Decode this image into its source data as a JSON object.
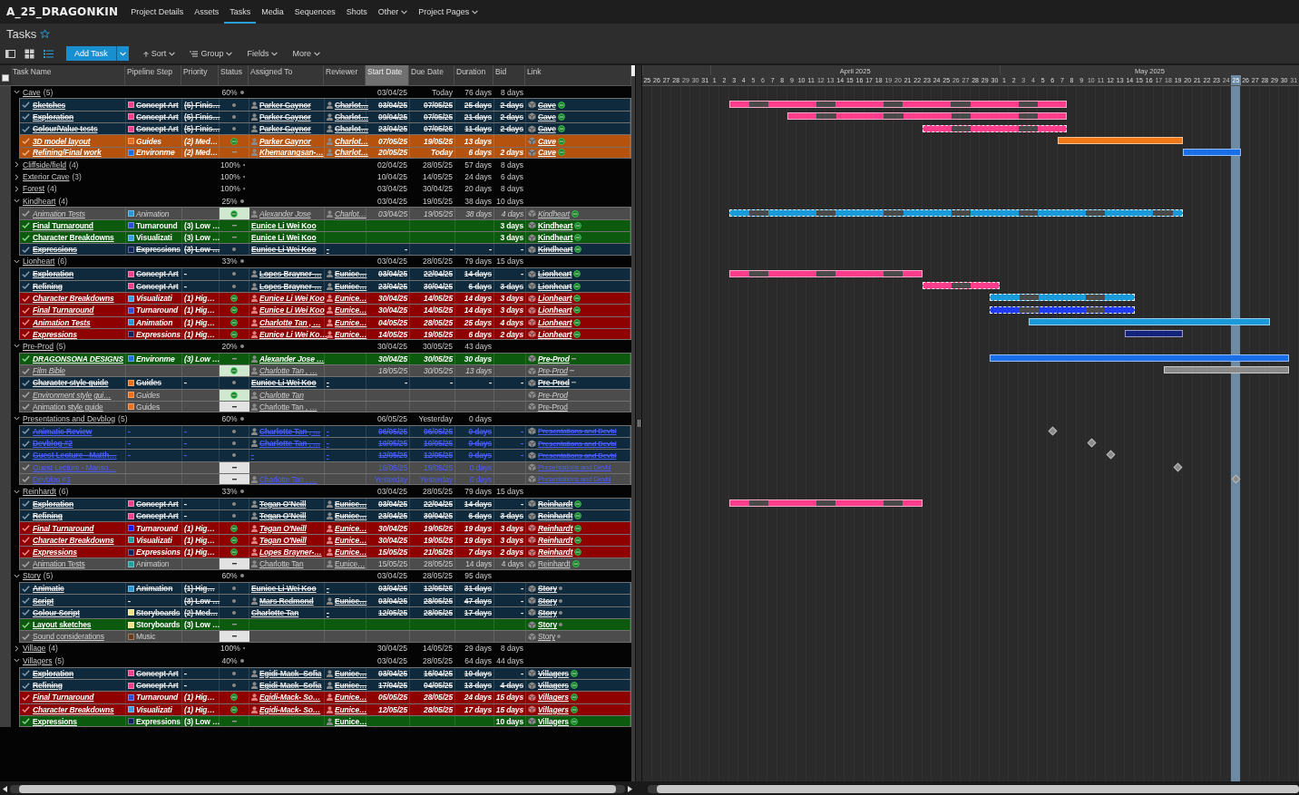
{
  "app": {
    "project": "A_25_DRAGONKIN"
  },
  "nav": [
    {
      "label": "Project Details",
      "selected": false,
      "menu": false
    },
    {
      "label": "Assets",
      "selected": false,
      "menu": false
    },
    {
      "label": "Tasks",
      "selected": true,
      "menu": false
    },
    {
      "label": "Media",
      "selected": false,
      "menu": false
    },
    {
      "label": "Sequences",
      "selected": false,
      "menu": false
    },
    {
      "label": "Shots",
      "selected": false,
      "menu": false
    },
    {
      "label": "Other",
      "selected": false,
      "menu": true
    },
    {
      "label": "Project Pages",
      "selected": false,
      "menu": true
    }
  ],
  "page": {
    "title": "Tasks",
    "favorite": false
  },
  "views": [
    {
      "kind": "detail",
      "selected": false
    },
    {
      "kind": "grid",
      "selected": false
    },
    {
      "kind": "list",
      "selected": true
    }
  ],
  "toolbar": {
    "add": "Add Task",
    "tools": [
      {
        "kind": "sort",
        "label": "Sort"
      },
      {
        "kind": "group",
        "label": "Group"
      },
      {
        "kind": "plain",
        "label": "Fields"
      },
      {
        "kind": "plain",
        "label": "More"
      }
    ]
  },
  "table": {
    "select_all": {
      "checked": false
    },
    "columns": [
      {
        "label": "Task Name",
        "sorted": false
      },
      {
        "label": "Pipeline Step",
        "sorted": false
      },
      {
        "label": "Priority",
        "sorted": false
      },
      {
        "label": "Status",
        "sorted": false
      },
      {
        "label": "Assigned To",
        "sorted": false
      },
      {
        "label": "Reviewer",
        "sorted": false
      },
      {
        "label": "Start Date",
        "sorted": true
      },
      {
        "label": "Due Date",
        "sorted": false
      },
      {
        "label": "Duration",
        "sorted": false
      },
      {
        "label": "Bid",
        "sorted": false
      },
      {
        "label": "Link",
        "sorted": false
      }
    ],
    "rows": [
      {
        "kind": "group",
        "expanded": true,
        "name": "Cave",
        "count": "(5)",
        "percent": "60%",
        "start": "03/04/25",
        "due": "Today",
        "duration": "76 days",
        "bid": "8 days"
      },
      {
        "kind": "done",
        "italic": false,
        "blue_text": false,
        "name": "Sketches",
        "step": {
          "label": "Concept Art",
          "color": "#f0408a"
        },
        "priority": "(5) Finis…",
        "status": {
          "kind": "final"
        },
        "assignee": "Parker Gaynor",
        "assignee_avatar": true,
        "reviewer": "Charlot…",
        "reviewer_avatar": true,
        "start": "03/04/25",
        "due": "07/05/25",
        "duration": "25 days",
        "bid": "2 days",
        "link": {
          "label": "Cave",
          "kind": "active"
        },
        "bar": {
          "kind": "split",
          "color": "#ff3d8b"
        }
      },
      {
        "kind": "done",
        "italic": false,
        "blue_text": false,
        "name": "Exploration",
        "step": {
          "label": "Concept Art",
          "color": "#f0408a"
        },
        "priority": "(5) Finis…",
        "status": {
          "kind": "final"
        },
        "assignee": "Parker Gaynor",
        "assignee_avatar": true,
        "reviewer": "Charlot…",
        "reviewer_avatar": true,
        "start": "09/04/25",
        "due": "07/05/25",
        "duration": "21 days",
        "bid": "2 days",
        "link": {
          "label": "Cave",
          "kind": "active"
        },
        "bar": {
          "kind": "split",
          "color": "#ff3d8b"
        }
      },
      {
        "kind": "done",
        "italic": false,
        "blue_text": false,
        "name": "Colour/Value tests",
        "step": {
          "label": "Concept Art",
          "color": "#f0408a"
        },
        "priority": "(5) Finis…",
        "status": {
          "kind": "final"
        },
        "assignee": "Parker Gaynor",
        "assignee_avatar": true,
        "reviewer": "Charlot…",
        "reviewer_avatar": true,
        "start": "23/04/25",
        "due": "07/05/25",
        "duration": "11 days",
        "bid": "2 days",
        "link": {
          "label": "Cave",
          "kind": "active"
        },
        "bar": {
          "kind": "dashed",
          "color": "#ff3d8b"
        }
      },
      {
        "kind": "late",
        "italic": true,
        "blue_text": false,
        "name": "3D model layout",
        "step": {
          "label": "Guides",
          "color": "#e8701a"
        },
        "priority": "(2) Med…",
        "status": {
          "kind": "ip"
        },
        "assignee": "Parker Gaynor",
        "assignee_avatar": true,
        "reviewer": "Charlot…",
        "reviewer_avatar": true,
        "start": "07/05/25",
        "due": "19/05/25",
        "duration": "13 days",
        "link": {
          "label": "Cave",
          "kind": "active"
        },
        "bar": {
          "kind": "solid",
          "color": "#f07818"
        }
      },
      {
        "kind": "late",
        "italic": true,
        "blue_text": false,
        "name": "Refining/Final work",
        "step": {
          "label": "Environme",
          "color": "#1a6ee8"
        },
        "priority": "(2) Med…",
        "status": {
          "kind": "wtg"
        },
        "assignee": "Khemarangsan-…",
        "assignee_avatar": true,
        "reviewer": "Charlot…",
        "reviewer_avatar": true,
        "start": "20/05/25",
        "due": "Today",
        "duration": "6 days",
        "bid": "2 days",
        "link": {
          "label": "Cave",
          "kind": "active"
        },
        "bar": {
          "kind": "solid",
          "color": "#1a6ee8"
        }
      },
      {
        "kind": "group",
        "expanded": false,
        "name": "Cliffside/field",
        "count": "(4)",
        "percent": "100%",
        "start": "02/04/25",
        "due": "28/05/25",
        "duration": "57 days",
        "bid": "8 days"
      },
      {
        "kind": "group",
        "expanded": false,
        "name": "Exterior Cave",
        "count": "(3)",
        "percent": "100%",
        "start": "10/04/25",
        "due": "14/05/25",
        "duration": "24 days",
        "bid": "6 days"
      },
      {
        "kind": "group",
        "expanded": false,
        "name": "Forest",
        "count": "(4)",
        "percent": "100%",
        "start": "03/04/25",
        "due": "30/04/25",
        "duration": "20 days",
        "bid": "8 days"
      },
      {
        "kind": "group",
        "expanded": true,
        "name": "Kindheart",
        "count": "(4)",
        "percent": "25%",
        "start": "03/04/25",
        "due": "19/05/25",
        "duration": "38 days",
        "bid": "10 days"
      },
      {
        "kind": "pending",
        "italic": true,
        "blue_text": false,
        "name": "Animation Tests",
        "step": {
          "label": "Animation",
          "color": "#2a96d4"
        },
        "status": {
          "kind": "ip_box"
        },
        "assignee": "Alexander Jose",
        "assignee_avatar": true,
        "reviewer": "Charlot…",
        "reviewer_avatar": true,
        "start": "03/04/25",
        "due": "19/05/25",
        "duration": "38 days",
        "bid": "4 days",
        "link": {
          "label": "Kindheart",
          "kind": "active"
        },
        "bar": {
          "kind": "dashed",
          "color": "#1a9ad8"
        }
      },
      {
        "kind": "active",
        "italic": false,
        "blue_text": false,
        "name": "Final Turnaround",
        "step": {
          "label": "Turnaround",
          "color": "#2b4fd0"
        },
        "priority": "(3) Low …",
        "status": {
          "kind": "wtg"
        },
        "assignee": "Eunice Li Wei Koo",
        "assignee_avatar": false,
        "bid": "3 days",
        "link": {
          "label": "Kindheart",
          "kind": "active"
        }
      },
      {
        "kind": "active",
        "italic": false,
        "blue_text": false,
        "name": "Character Breakdowns",
        "step": {
          "label": "Visualizati",
          "color": "#35a0e0"
        },
        "priority": "(3) Low …",
        "status": {
          "kind": "wtg"
        },
        "assignee": "Eunice Li Wei Koo",
        "assignee_avatar": false,
        "bid": "3 days",
        "link": {
          "label": "Kindheart",
          "kind": "active"
        }
      },
      {
        "kind": "done",
        "italic": false,
        "blue_text": false,
        "name": "Expressions",
        "step": {
          "label": "Expressions",
          "color": "#10205a"
        },
        "priority": "(3) Low …",
        "status": {
          "kind": "final"
        },
        "assignee": "Eunice Li Wei Koo",
        "assignee_avatar": false,
        "reviewer": "-",
        "reviewer_avatar": false,
        "start": "-",
        "due": "-",
        "duration": "-",
        "bid": "-",
        "link": {
          "label": "Kindheart",
          "kind": "active"
        }
      },
      {
        "kind": "group",
        "expanded": true,
        "name": "Lionheart",
        "count": "(6)",
        "percent": "33%",
        "start": "03/04/25",
        "due": "28/05/25",
        "duration": "79 days",
        "bid": "15 days"
      },
      {
        "kind": "done",
        "italic": false,
        "blue_text": false,
        "name": "Exploration",
        "step": {
          "label": "Concept Art",
          "color": "#f0408a"
        },
        "priority": "-",
        "status": {
          "kind": "final"
        },
        "assignee": "Lopes Brayner-…",
        "assignee_avatar": true,
        "reviewer": "Eunice…",
        "reviewer_avatar": true,
        "start": "03/04/25",
        "due": "22/04/25",
        "duration": "14 days",
        "bid": "-",
        "link": {
          "label": "Lionheart",
          "kind": "active"
        },
        "bar": {
          "kind": "split",
          "color": "#ff3d8b"
        }
      },
      {
        "kind": "done",
        "italic": false,
        "blue_text": false,
        "name": "Refining",
        "step": {
          "label": "Concept Art",
          "color": "#f0408a"
        },
        "priority": "-",
        "status": {
          "kind": "final"
        },
        "assignee": "Lopes Brayner-…",
        "assignee_avatar": true,
        "reviewer": "Eunice…",
        "reviewer_avatar": true,
        "start": "23/04/25",
        "due": "30/04/25",
        "duration": "6 days",
        "bid": "3 days",
        "link": {
          "label": "Lionheart",
          "kind": "active"
        },
        "bar": {
          "kind": "dashed",
          "color": "#ff3d8b"
        }
      },
      {
        "kind": "overdue",
        "italic": true,
        "blue_text": false,
        "name": "Character Breakdowns",
        "step": {
          "label": "Visualizati",
          "color": "#35a0e0"
        },
        "priority": "(1) Hig…",
        "status": {
          "kind": "ip"
        },
        "assignee": "Eunice Li Wei Koo",
        "assignee_avatar": true,
        "reviewer": "Eunice…",
        "reviewer_avatar": true,
        "start": "30/04/25",
        "due": "14/05/25",
        "duration": "14 days",
        "bid": "3 days",
        "link": {
          "label": "Lionheart",
          "kind": "active"
        },
        "bar": {
          "kind": "dashed",
          "color": "#1a9ad8"
        }
      },
      {
        "kind": "overdue",
        "italic": true,
        "blue_text": false,
        "name": "Final Turnaround",
        "step": {
          "label": "Turnaround",
          "color": "#2b4fd0"
        },
        "priority": "(1) Hig…",
        "status": {
          "kind": "ip"
        },
        "assignee": "Eunice Li Wei Koo",
        "assignee_avatar": true,
        "reviewer": "Eunice…",
        "reviewer_avatar": true,
        "start": "30/04/25",
        "due": "14/05/25",
        "duration": "14 days",
        "bid": "3 days",
        "link": {
          "label": "Lionheart",
          "kind": "active"
        },
        "bar": {
          "kind": "dashed",
          "color": "#1f3cf0"
        }
      },
      {
        "kind": "overdue",
        "italic": true,
        "blue_text": false,
        "name": "Animation Tests",
        "step": {
          "label": "Animation",
          "color": "#2a96d4"
        },
        "priority": "(1) Hig…",
        "status": {
          "kind": "ip"
        },
        "assignee": "Charlotte Tan , …",
        "assignee_avatar": true,
        "reviewer": "Eunice…",
        "reviewer_avatar": true,
        "start": "04/05/25",
        "due": "28/05/25",
        "duration": "25 days",
        "bid": "4 days",
        "link": {
          "label": "Lionheart",
          "kind": "active"
        },
        "bar": {
          "kind": "solid",
          "color": "#1a9ad8"
        }
      },
      {
        "kind": "overdue",
        "italic": true,
        "blue_text": false,
        "name": "Expressions",
        "step": {
          "label": "Expressions",
          "color": "#10205a"
        },
        "priority": "(1) Hig…",
        "status": {
          "kind": "ip"
        },
        "assignee": "Eunice Li Wei Ko…",
        "assignee_avatar": true,
        "reviewer": "Eunice…",
        "reviewer_avatar": true,
        "start": "14/05/25",
        "due": "19/05/25",
        "duration": "6 days",
        "bid": "2 days",
        "link": {
          "label": "Lionheart",
          "kind": "active"
        },
        "bar": {
          "kind": "solid",
          "color": "#14237a"
        }
      },
      {
        "kind": "group",
        "expanded": true,
        "name": "Pre-Prod",
        "count": "(5)",
        "percent": "20%",
        "start": "30/04/25",
        "due": "30/05/25",
        "duration": "43 days"
      },
      {
        "kind": "active",
        "italic": true,
        "blue_text": false,
        "name": "DRAGONSONA DESIGNS",
        "step": {
          "label": "Environme",
          "color": "#1a6ee8"
        },
        "priority": "(3) Low …",
        "status": {
          "kind": "wtg"
        },
        "assignee": "Alexander Jose …",
        "assignee_avatar": true,
        "start": "30/04/25",
        "due": "30/05/25",
        "duration": "30 days",
        "link": {
          "label": "Pre-Prod",
          "kind": "waiting"
        },
        "bar": {
          "kind": "solid",
          "color": "#1a6ee8"
        }
      },
      {
        "kind": "pending",
        "italic": true,
        "blue_text": false,
        "name": "Film Bible",
        "status": {
          "kind": "ip_box"
        },
        "assignee": "Charlotte Tan , …",
        "assignee_avatar": true,
        "start": "18/05/25",
        "due": "30/05/25",
        "duration": "13 days",
        "link": {
          "label": "Pre-Prod",
          "kind": "waiting"
        },
        "bar": {
          "kind": "solid",
          "color": "#8a8a8a"
        }
      },
      {
        "kind": "done",
        "italic": false,
        "blue_text": false,
        "name": "Character style guide",
        "step": {
          "label": "Guides",
          "color": "#e8701a"
        },
        "priority": "-",
        "status": {
          "kind": "final"
        },
        "assignee": "Eunice Li Wei Koo",
        "assignee_avatar": false,
        "reviewer": "-",
        "reviewer_avatar": false,
        "start": "-",
        "due": "-",
        "duration": "-",
        "bid": "-",
        "link": {
          "label": "Pre-Prod",
          "kind": "waiting"
        }
      },
      {
        "kind": "pending",
        "italic": true,
        "blue_text": false,
        "name": "Environment style gui…",
        "step": {
          "label": "Guides",
          "color": "#e8701a"
        },
        "status": {
          "kind": "ip_box"
        },
        "assignee": "Charlotte Tan",
        "assignee_avatar": true,
        "link": {
          "label": "Pre-Prod",
          "kind": "plain"
        }
      },
      {
        "kind": "pending",
        "italic": false,
        "blue_text": false,
        "name": "Animation style guide",
        "step": {
          "label": "Guides",
          "color": "#e8701a"
        },
        "status": {
          "kind": "wtg_box"
        },
        "assignee": "Charlotte Tan , …",
        "assignee_avatar": true,
        "link": {
          "label": "Pre-Prod",
          "kind": "plain"
        }
      },
      {
        "kind": "group",
        "expanded": true,
        "name": "Presentations and Devblog",
        "count": "(5)",
        "percent": "60%",
        "start": "06/05/25",
        "due": "Yesterday",
        "duration": "0 days"
      },
      {
        "kind": "done",
        "italic": false,
        "blue_text": true,
        "name": "Animatic Review",
        "step": {
          "label": "-"
        },
        "priority": "-",
        "status": {
          "kind": "final"
        },
        "assignee": "Charlotte Tan , …",
        "assignee_avatar": true,
        "reviewer": "-",
        "reviewer_avatar": false,
        "start": "06/05/25",
        "due": "06/05/25",
        "duration": "0 days",
        "bid": "-",
        "link": {
          "label": "Presentations and Devbl",
          "kind": "plain"
        },
        "bar": {
          "kind": "milestone",
          "color": "#8a8a8a"
        }
      },
      {
        "kind": "done",
        "italic": false,
        "blue_text": true,
        "name": "Devblog #2",
        "step": {
          "label": "-"
        },
        "priority": "-",
        "status": {
          "kind": "final"
        },
        "assignee": "Charlotte Tan , …",
        "assignee_avatar": true,
        "reviewer": "-",
        "reviewer_avatar": false,
        "start": "10/05/25",
        "due": "10/05/25",
        "duration": "0 days",
        "bid": "-",
        "link": {
          "label": "Presentations and Devbl",
          "kind": "plain"
        },
        "bar": {
          "kind": "milestone",
          "color": "#8a8a8a"
        }
      },
      {
        "kind": "done",
        "italic": false,
        "blue_text": true,
        "name": "Guest Lecture - Matth…",
        "step": {
          "label": "-"
        },
        "priority": "-",
        "status": {
          "kind": "final"
        },
        "assignee": "-",
        "assignee_avatar": false,
        "reviewer": "-",
        "reviewer_avatar": false,
        "start": "12/05/25",
        "due": "12/05/25",
        "duration": "0 days",
        "bid": "-",
        "link": {
          "label": "Presentations and Devbl",
          "kind": "plain"
        },
        "bar": {
          "kind": "milestone",
          "color": "#8a8a8a"
        }
      },
      {
        "kind": "pending",
        "italic": false,
        "blue_text": true,
        "name": "Guest Lecture - Manso…",
        "status": {
          "kind": "wtg_box"
        },
        "start": "19/05/25",
        "due": "19/05/25",
        "duration": "0 days",
        "link": {
          "label": "Presentations and Devbl",
          "kind": "plain"
        },
        "bar": {
          "kind": "milestone",
          "color": "#8a8a8a"
        }
      },
      {
        "kind": "pending",
        "italic": false,
        "blue_text": true,
        "name": "Devblog #3",
        "status": {
          "kind": "wtg_box"
        },
        "assignee": "Charlotte Tan , …",
        "assignee_avatar": true,
        "start": "Yesterday",
        "due": "Yesterday",
        "duration": "0 days",
        "link": {
          "label": "Presentations and Devbl",
          "kind": "plain"
        },
        "bar": {
          "kind": "milestone",
          "color": "#8a8a8a"
        }
      },
      {
        "kind": "group",
        "expanded": true,
        "name": "Reinhardt",
        "count": "(6)",
        "percent": "33%",
        "start": "03/04/25",
        "due": "28/05/25",
        "duration": "79 days",
        "bid": "15 days"
      },
      {
        "kind": "done",
        "italic": false,
        "blue_text": false,
        "name": "Exploration",
        "step": {
          "label": "Concept Art",
          "color": "#f0408a"
        },
        "priority": "-",
        "status": {
          "kind": "final"
        },
        "assignee": "Tegan O'Neill",
        "assignee_avatar": true,
        "reviewer": "Eunice…",
        "reviewer_avatar": true,
        "start": "03/04/25",
        "due": "22/04/25",
        "duration": "14 days",
        "bid": "-",
        "link": {
          "label": "Reinhardt",
          "kind": "active"
        },
        "bar": {
          "kind": "split",
          "color": "#ff3d8b"
        }
      },
      {
        "kind": "done",
        "italic": false,
        "blue_text": false,
        "name": "Refining",
        "step": {
          "label": "Concept Art",
          "color": "#f0408a"
        },
        "priority": "-",
        "status": {
          "kind": "final"
        },
        "assignee": "Tegan O'Neill",
        "assignee_avatar": true,
        "reviewer": "Eunice…",
        "reviewer_avatar": true,
        "start": "23/04/25",
        "due": "30/04/25",
        "duration": "6 days",
        "bid": "3 days",
        "link": {
          "label": "Reinhardt",
          "kind": "active"
        }
      },
      {
        "kind": "overdue",
        "italic": true,
        "blue_text": false,
        "name": "Final Turnaround",
        "step": {
          "label": "Turnaround",
          "color": "#1a1ae8"
        },
        "priority": "(1) Hig…",
        "status": {
          "kind": "ip"
        },
        "assignee": "Tegan O'Neill",
        "assignee_avatar": true,
        "reviewer": "Eunice…",
        "reviewer_avatar": true,
        "start": "30/04/25",
        "due": "19/05/25",
        "duration": "19 days",
        "bid": "3 days",
        "link": {
          "label": "Reinhardt",
          "kind": "active"
        }
      },
      {
        "kind": "overdue",
        "italic": true,
        "blue_text": false,
        "name": "Character Breakdowns",
        "step": {
          "label": "Visualizati",
          "color": "#20a0a0"
        },
        "priority": "(1) Hig…",
        "status": {
          "kind": "ip"
        },
        "assignee": "Tegan O'Neill",
        "assignee_avatar": true,
        "reviewer": "Eunice…",
        "reviewer_avatar": true,
        "start": "30/04/25",
        "due": "19/05/25",
        "duration": "19 days",
        "bid": "3 days",
        "link": {
          "label": "Reinhardt",
          "kind": "active"
        }
      },
      {
        "kind": "overdue",
        "italic": true,
        "blue_text": false,
        "name": "Expressions",
        "step": {
          "label": "Expressions",
          "color": "#10205a"
        },
        "priority": "(1) Hig…",
        "status": {
          "kind": "ip"
        },
        "assignee": "Lopes Brayner-…",
        "assignee_avatar": true,
        "reviewer": "Eunice…",
        "reviewer_avatar": true,
        "start": "15/05/25",
        "due": "21/05/25",
        "duration": "7 days",
        "bid": "2 days",
        "link": {
          "label": "Reinhardt",
          "kind": "active"
        }
      },
      {
        "kind": "pending",
        "italic": false,
        "blue_text": false,
        "name": "Animation Tests",
        "step": {
          "label": "Animation",
          "color": "#20a0a0"
        },
        "status": {
          "kind": "wtg_box"
        },
        "assignee": "Charlotte Tan",
        "assignee_avatar": true,
        "reviewer": "Eunice…",
        "reviewer_avatar": true,
        "start": "15/05/25",
        "due": "28/05/25",
        "duration": "14 days",
        "bid": "4 days",
        "link": {
          "label": "Reinhardt",
          "kind": "active"
        }
      },
      {
        "kind": "group",
        "expanded": true,
        "name": "Story",
        "count": "(5)",
        "percent": "60%",
        "start": "03/04/25",
        "due": "28/05/25",
        "duration": "95 days"
      },
      {
        "kind": "done",
        "italic": false,
        "blue_text": false,
        "name": "Animatic",
        "step": {
          "label": "Animation",
          "color": "#2a96d4"
        },
        "priority": "(1) Hig…",
        "status": {
          "kind": "final"
        },
        "assignee": "Eunice Li Wei Koo",
        "assignee_avatar": false,
        "reviewer": "-",
        "reviewer_avatar": false,
        "start": "03/04/25",
        "due": "12/05/25",
        "duration": "31 days",
        "bid": "-",
        "link": {
          "label": "Story",
          "kind": "closed"
        }
      },
      {
        "kind": "done",
        "italic": false,
        "blue_text": false,
        "name": "Script",
        "step": {
          "label": "-"
        },
        "priority": "(3) Low …",
        "status": {
          "kind": "final"
        },
        "assignee": "Mars Redmond",
        "assignee_avatar": true,
        "reviewer": "Eunice…",
        "reviewer_avatar": true,
        "start": "03/04/25",
        "due": "28/05/25",
        "duration": "47 days",
        "bid": "-",
        "link": {
          "label": "Story",
          "kind": "closed"
        }
      },
      {
        "kind": "done",
        "italic": false,
        "blue_text": false,
        "name": "Colour Script",
        "step": {
          "label": "Storyboards",
          "color": "#f0e08a"
        },
        "priority": "(2) Med…",
        "status": {
          "kind": "final"
        },
        "assignee": "Charlotte Tan",
        "assignee_avatar": false,
        "reviewer": "-",
        "reviewer_avatar": false,
        "start": "12/05/25",
        "due": "28/05/25",
        "duration": "17 days",
        "bid": "-",
        "link": {
          "label": "Story",
          "kind": "closed"
        }
      },
      {
        "kind": "active",
        "italic": false,
        "blue_text": false,
        "name": "Layout sketches",
        "step": {
          "label": "Storyboards",
          "color": "#f0e08a"
        },
        "priority": "(3) Low …",
        "status": {
          "kind": "wtg"
        },
        "link": {
          "label": "Story",
          "kind": "closed"
        }
      },
      {
        "kind": "pending",
        "italic": false,
        "blue_text": false,
        "name": "Sound considerations",
        "step": {
          "label": "Music",
          "color": "#6a3a1a"
        },
        "status": {
          "kind": "wtg_box"
        },
        "link": {
          "label": "Story",
          "kind": "closed"
        }
      },
      {
        "kind": "group",
        "expanded": false,
        "name": "Village",
        "count": "(4)",
        "percent": "100%",
        "start": "30/04/25",
        "due": "14/05/25",
        "duration": "29 days",
        "bid": "8 days"
      },
      {
        "kind": "group",
        "expanded": true,
        "name": "Villagers",
        "count": "(5)",
        "percent": "40%",
        "start": "03/04/25",
        "due": "28/05/25",
        "duration": "64 days",
        "bid": "44 days"
      },
      {
        "kind": "done",
        "italic": false,
        "blue_text": false,
        "name": "Exploration",
        "step": {
          "label": "Concept Art",
          "color": "#f0408a"
        },
        "priority": "-",
        "status": {
          "kind": "final"
        },
        "assignee": "Egidi-Mack- Sofia",
        "assignee_avatar": true,
        "reviewer": "Eunice…",
        "reviewer_avatar": true,
        "start": "03/04/25",
        "due": "16/04/25",
        "duration": "10 days",
        "bid": "-",
        "link": {
          "label": "Villagers",
          "kind": "active"
        }
      },
      {
        "kind": "done",
        "italic": false,
        "blue_text": false,
        "name": "Refining",
        "step": {
          "label": "Concept Art",
          "color": "#f0408a"
        },
        "priority": "-",
        "status": {
          "kind": "final"
        },
        "assignee": "Egidi-Mack- Sofia",
        "assignee_avatar": true,
        "reviewer": "Eunice…",
        "reviewer_avatar": true,
        "start": "17/04/25",
        "due": "04/05/25",
        "duration": "13 days",
        "bid": "4 days",
        "link": {
          "label": "Villagers",
          "kind": "active"
        }
      },
      {
        "kind": "overdue",
        "italic": true,
        "blue_text": false,
        "name": "Final Turnaround",
        "step": {
          "label": "Turnaround",
          "color": "#2b4fd0"
        },
        "priority": "(1) Hig…",
        "status": {
          "kind": "ip"
        },
        "assignee": "Egidi-Mack- So…",
        "assignee_avatar": true,
        "reviewer": "Eunice…",
        "reviewer_avatar": true,
        "start": "05/05/25",
        "due": "28/05/25",
        "duration": "24 days",
        "bid": "15 days",
        "link": {
          "label": "Villagers",
          "kind": "active"
        }
      },
      {
        "kind": "overdue",
        "italic": true,
        "blue_text": false,
        "name": "Character Breakdowns",
        "step": {
          "label": "Visualizati",
          "color": "#35a0e0"
        },
        "priority": "(1) Hig…",
        "status": {
          "kind": "ip"
        },
        "assignee": "Egidi-Mack- So…",
        "assignee_avatar": true,
        "reviewer": "Eunice…",
        "reviewer_avatar": true,
        "start": "12/05/25",
        "due": "28/05/25",
        "duration": "17 days",
        "bid": "15 days",
        "link": {
          "label": "Villagers",
          "kind": "active"
        }
      },
      {
        "kind": "active",
        "italic": false,
        "blue_text": false,
        "name": "Expressions",
        "step": {
          "label": "Expressions",
          "color": "#10205a"
        },
        "priority": "(3) Low …",
        "status": {
          "kind": "wtg"
        },
        "reviewer": "Eunice…",
        "reviewer_avatar": true,
        "bid": "10 days",
        "link": {
          "label": "Villagers",
          "kind": "active"
        }
      }
    ]
  },
  "timeline": {
    "months": [
      {
        "days": [
          {
            "label": "25",
            "weekend": false,
            "today": false
          },
          {
            "label": "26",
            "weekend": false,
            "today": false
          },
          {
            "label": "27",
            "weekend": false,
            "today": false
          },
          {
            "label": "28",
            "weekend": false,
            "today": false
          },
          {
            "label": "29",
            "weekend": true,
            "today": false
          },
          {
            "label": "30",
            "weekend": true,
            "today": false
          },
          {
            "label": "31",
            "weekend": false,
            "today": false
          }
        ]
      },
      {
        "label": "April 2025",
        "days": [
          {
            "label": "1",
            "weekend": false,
            "today": false
          },
          {
            "label": "2",
            "weekend": false,
            "today": false
          },
          {
            "label": "3",
            "weekend": false,
            "today": false
          },
          {
            "label": "4",
            "weekend": false,
            "today": false
          },
          {
            "label": "5",
            "weekend": true,
            "today": false
          },
          {
            "label": "6",
            "weekend": true,
            "today": false
          },
          {
            "label": "7",
            "weekend": false,
            "today": false
          },
          {
            "label": "8",
            "weekend": false,
            "today": false
          },
          {
            "label": "9",
            "weekend": false,
            "today": false
          },
          {
            "label": "10",
            "weekend": false,
            "today": false
          },
          {
            "label": "11",
            "weekend": false,
            "today": false
          },
          {
            "label": "12",
            "weekend": true,
            "today": false
          },
          {
            "label": "13",
            "weekend": true,
            "today": false
          },
          {
            "label": "14",
            "weekend": false,
            "today": false
          },
          {
            "label": "15",
            "weekend": false,
            "today": false
          },
          {
            "label": "16",
            "weekend": false,
            "today": false
          },
          {
            "label": "17",
            "weekend": false,
            "today": false
          },
          {
            "label": "18",
            "weekend": false,
            "today": false
          },
          {
            "label": "19",
            "weekend": true,
            "today": false
          },
          {
            "label": "20",
            "weekend": true,
            "today": false
          },
          {
            "label": "21",
            "weekend": false,
            "today": false
          },
          {
            "label": "22",
            "weekend": false,
            "today": false
          },
          {
            "label": "23",
            "weekend": false,
            "today": false
          },
          {
            "label": "24",
            "weekend": false,
            "today": false
          },
          {
            "label": "25",
            "weekend": false,
            "today": false
          },
          {
            "label": "26",
            "weekend": true,
            "today": false
          },
          {
            "label": "27",
            "weekend": true,
            "today": false
          },
          {
            "label": "28",
            "weekend": false,
            "today": false
          },
          {
            "label": "29",
            "weekend": false,
            "today": false
          },
          {
            "label": "30",
            "weekend": false,
            "today": false
          }
        ]
      },
      {
        "label": "May 2025",
        "days": [
          {
            "label": "1",
            "weekend": false,
            "today": false
          },
          {
            "label": "2",
            "weekend": false,
            "today": false
          },
          {
            "label": "3",
            "weekend": true,
            "today": false
          },
          {
            "label": "4",
            "weekend": true,
            "today": false
          },
          {
            "label": "5",
            "weekend": false,
            "today": false
          },
          {
            "label": "6",
            "weekend": false,
            "today": false
          },
          {
            "label": "7",
            "weekend": false,
            "today": false
          },
          {
            "label": "8",
            "weekend": false,
            "today": false
          },
          {
            "label": "9",
            "weekend": false,
            "today": false
          },
          {
            "label": "10",
            "weekend": true,
            "today": false
          },
          {
            "label": "11",
            "weekend": true,
            "today": false
          },
          {
            "label": "12",
            "weekend": false,
            "today": false
          },
          {
            "label": "13",
            "weekend": false,
            "today": false
          },
          {
            "label": "14",
            "weekend": false,
            "today": false
          },
          {
            "label": "15",
            "weekend": false,
            "today": false
          },
          {
            "label": "16",
            "weekend": false,
            "today": false
          },
          {
            "label": "17",
            "weekend": true,
            "today": false
          },
          {
            "label": "18",
            "weekend": true,
            "today": false
          },
          {
            "label": "19",
            "weekend": false,
            "today": false
          },
          {
            "label": "20",
            "weekend": false,
            "today": false
          },
          {
            "label": "21",
            "weekend": false,
            "today": false
          },
          {
            "label": "22",
            "weekend": false,
            "today": false
          },
          {
            "label": "23",
            "weekend": false,
            "today": false
          },
          {
            "label": "24",
            "weekend": true,
            "today": false
          },
          {
            "label": "25",
            "weekend": true,
            "today": true
          },
          {
            "label": "26",
            "weekend": false,
            "today": false
          },
          {
            "label": "27",
            "weekend": false,
            "today": false
          },
          {
            "label": "28",
            "weekend": false,
            "today": false
          },
          {
            "label": "29",
            "weekend": false,
            "today": false
          },
          {
            "label": "30",
            "weekend": false,
            "today": false
          },
          {
            "label": "31",
            "weekend": true,
            "today": false
          }
        ]
      }
    ]
  }
}
